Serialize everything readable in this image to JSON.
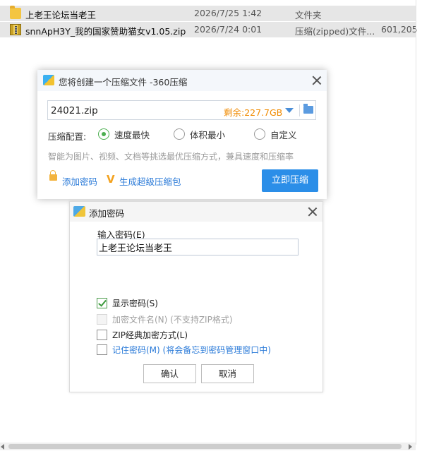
{
  "files": [
    {
      "name": "上老王论坛当老王",
      "date": "2026/7/25 1:42",
      "type": "文件夹",
      "size": "",
      "icon": "folder-icon"
    },
    {
      "name": "snnApH3Y_我的国家赞助猫女v1.05.zip",
      "date": "2026/7/24 0:01",
      "type": "压缩(zipped)文件...",
      "size": "601,205",
      "icon": "zip-icon"
    }
  ],
  "compress_dialog": {
    "title": "您将创建一个压缩文件 -360压缩",
    "filename": "24021.zip",
    "remaining": "剩余:227.7GB",
    "config_label": "压缩配置:",
    "options": [
      "速度最快",
      "体积最小",
      "自定义"
    ],
    "selected_option": "速度最快",
    "hint": "智能为图片、视频、文档等挑选最优压缩方式，兼具速度和压缩率",
    "add_password": "添加密码",
    "super_pack": "生成超级压缩包",
    "compress_now": "立即压缩"
  },
  "password_dialog": {
    "title": "添加密码",
    "label": "输入密码(E)",
    "value": "上老王论坛当老王",
    "options": [
      {
        "label": "显示密码(S)",
        "checked": true,
        "disabled": false
      },
      {
        "label": "加密文件名(N) (不支持ZIP格式)",
        "checked": false,
        "disabled": true
      },
      {
        "label": "ZIP经典加密方式(L)",
        "checked": false,
        "disabled": false
      },
      {
        "label": "记住密码(M) (将会备忘到密码管理窗口中)",
        "checked": false,
        "disabled": false
      }
    ],
    "ok": "确认",
    "cancel": "取消"
  },
  "colors": {
    "accent": "#2b8ee8",
    "remaining": "#f08a00",
    "radio_on": "#4caf50",
    "link": "#2a7ad8"
  }
}
